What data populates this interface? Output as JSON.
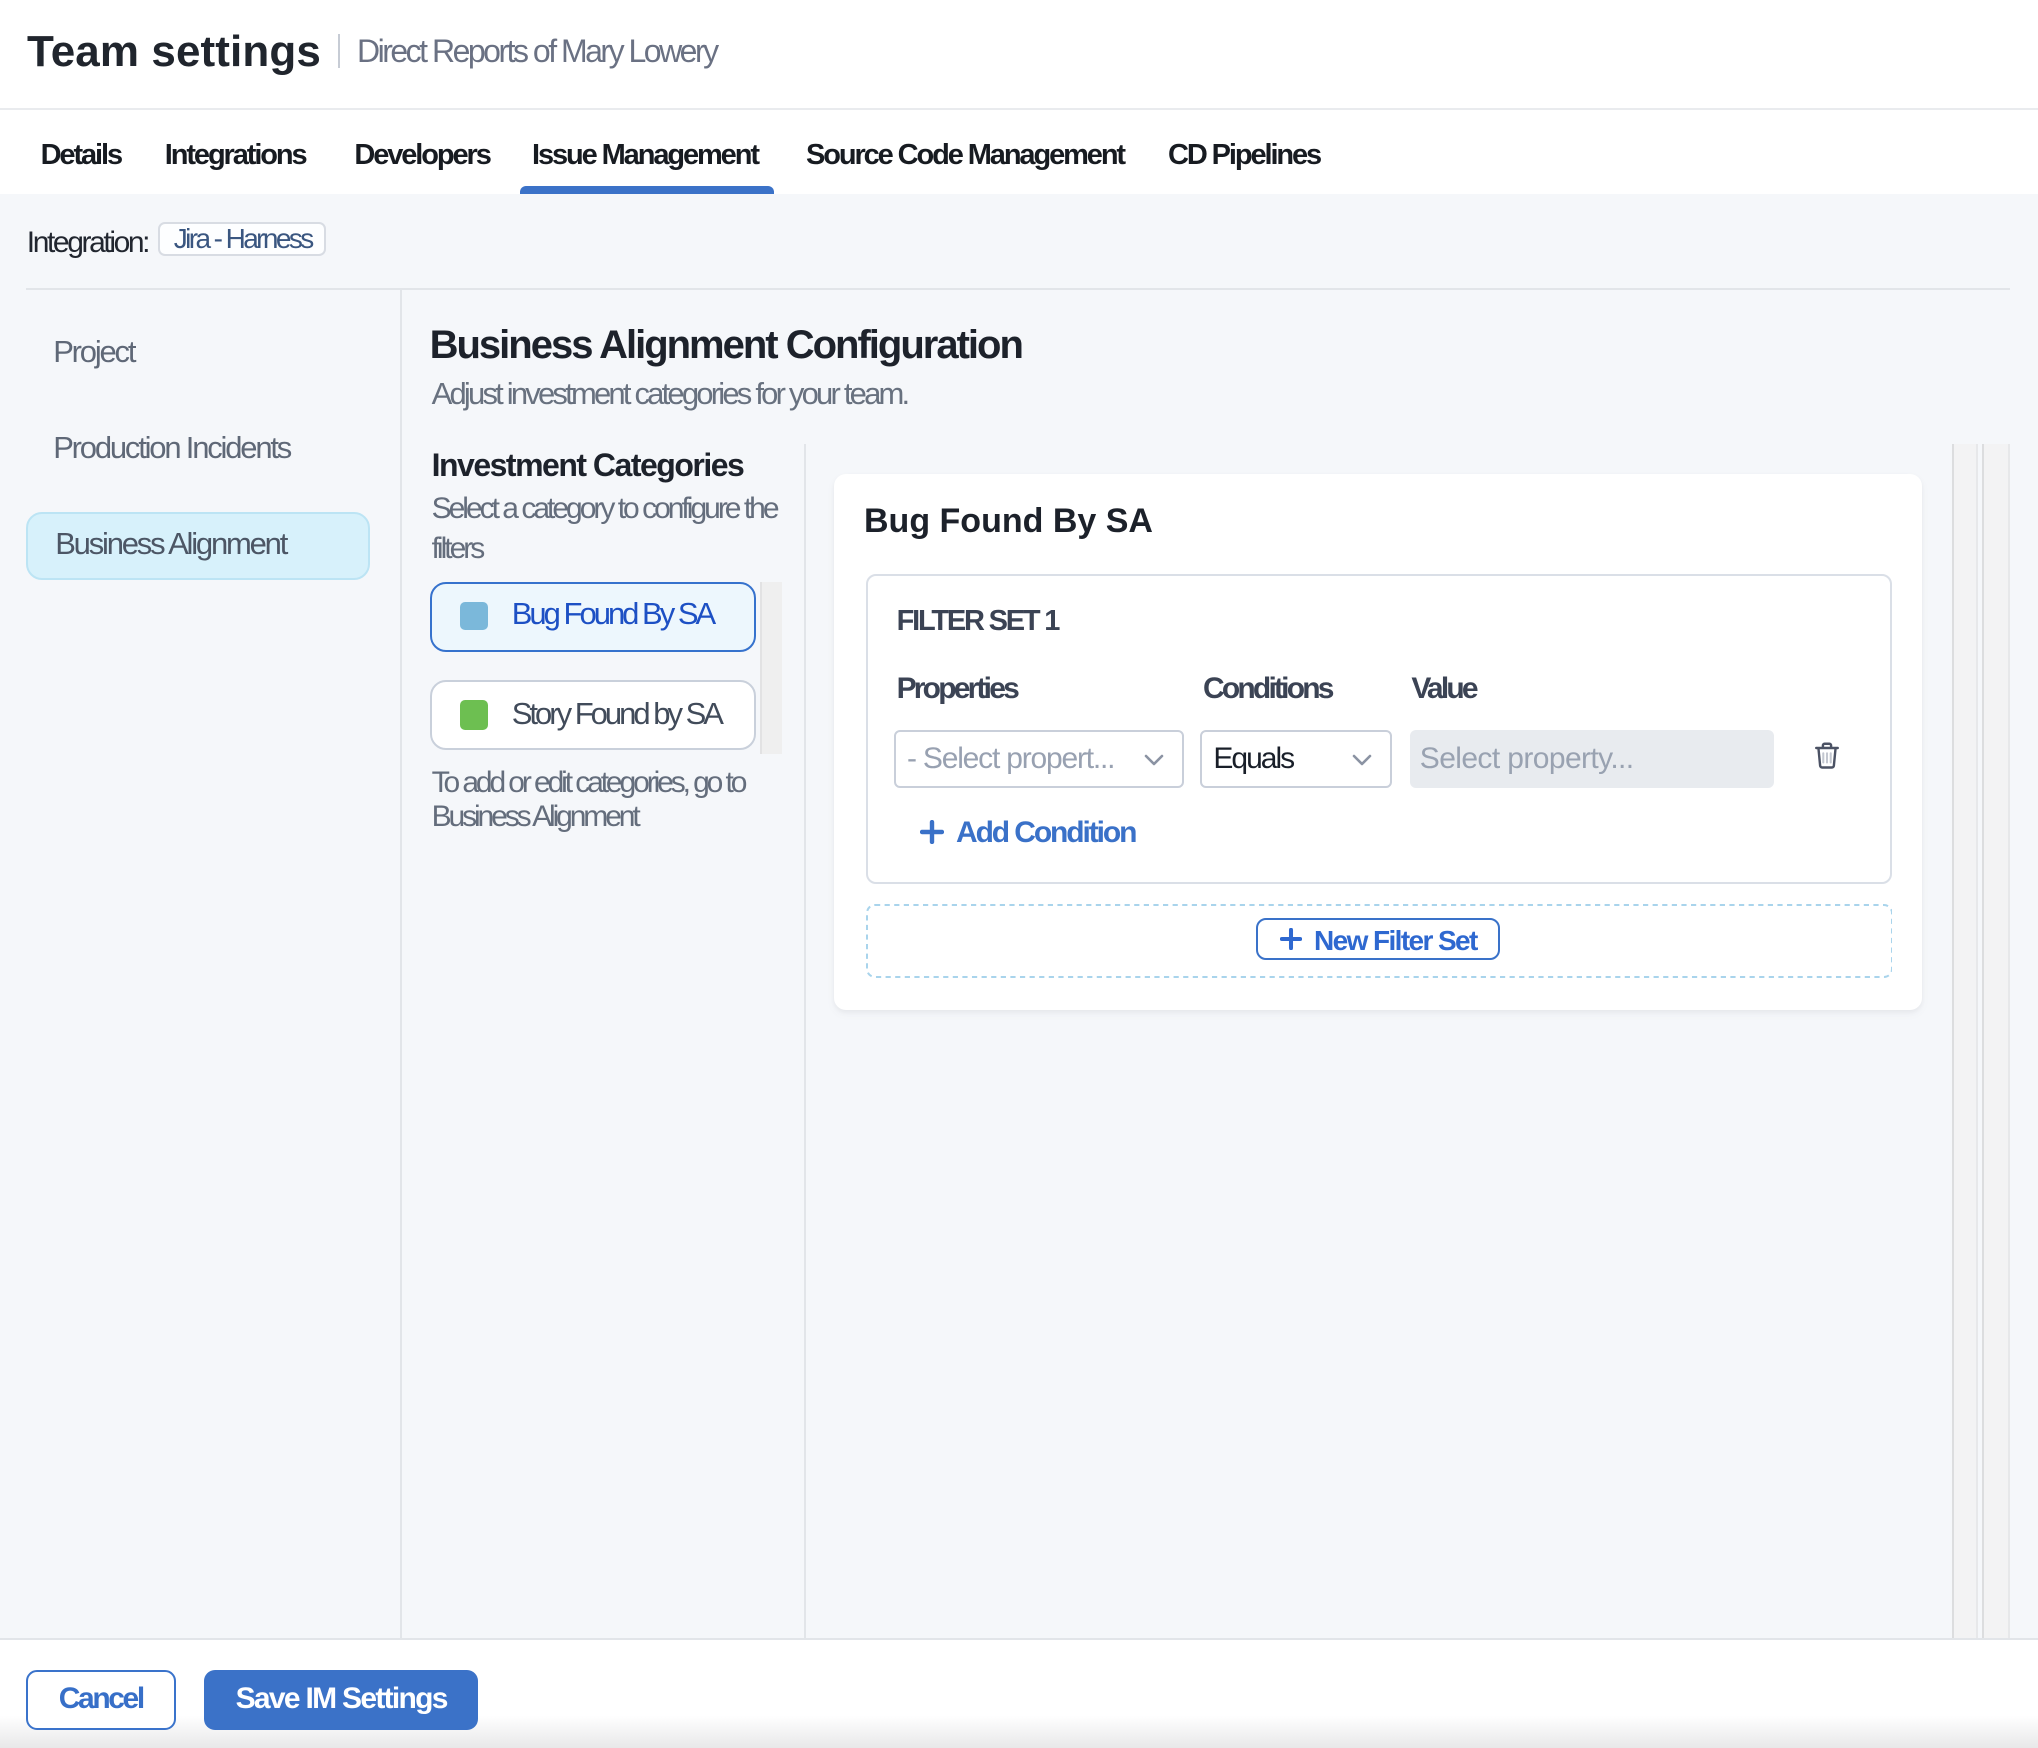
{
  "header": {
    "title": "Team settings",
    "subtitle": "Direct Reports of Mary Lowery"
  },
  "tabs": {
    "items": [
      {
        "label": "Details",
        "active": false
      },
      {
        "label": "Integrations",
        "active": false
      },
      {
        "label": "Developers",
        "active": false
      },
      {
        "label": "Issue Management",
        "active": true
      },
      {
        "label": "Source Code Management",
        "active": false
      },
      {
        "label": "CD Pipelines",
        "active": false
      }
    ]
  },
  "integration": {
    "label": "Integration:",
    "chip": "Jira - Harness"
  },
  "sidebar": {
    "items": [
      {
        "label": "Project",
        "selected": false
      },
      {
        "label": "Production Incidents",
        "selected": false
      },
      {
        "label": "Business Alignment",
        "selected": true
      }
    ]
  },
  "main": {
    "title": "Business Alignment Configuration",
    "subtitle": "Adjust investment categories for your team.",
    "categories": {
      "title": "Investment Categories",
      "hint": "Select a category to configure the filters",
      "items": [
        {
          "label": "Bug Found By SA",
          "swatch_color": "#7bb8da",
          "selected": true
        },
        {
          "label": "Story Found by SA",
          "swatch_color": "#6dbf51",
          "selected": false
        }
      ],
      "footnote": "To add or edit categories, go to Business Alignment"
    },
    "card": {
      "title": "Bug Found By SA",
      "filter_set_label": "FILTER SET 1",
      "columns": [
        "Properties",
        "Conditions",
        "Value"
      ],
      "row": {
        "property_placeholder": "- Select propert...",
        "condition_value": "Equals",
        "value_placeholder": "Select property..."
      },
      "add_condition_label": "Add Condition",
      "new_filter_set_label": "New Filter Set"
    }
  },
  "footer": {
    "cancel_label": "Cancel",
    "save_label": "Save IM Settings"
  },
  "colors": {
    "primary_blue": "#3b72c8",
    "link_blue": "#3a71c8",
    "selected_category_text": "#1d50c4",
    "selected_category_bg": "#edf7fd",
    "sidebar_selected_bg": "#d7f1fb",
    "content_bg": "#f5f7fa",
    "swatch_blue": "#7bb8da",
    "swatch_green": "#6dbf51"
  }
}
